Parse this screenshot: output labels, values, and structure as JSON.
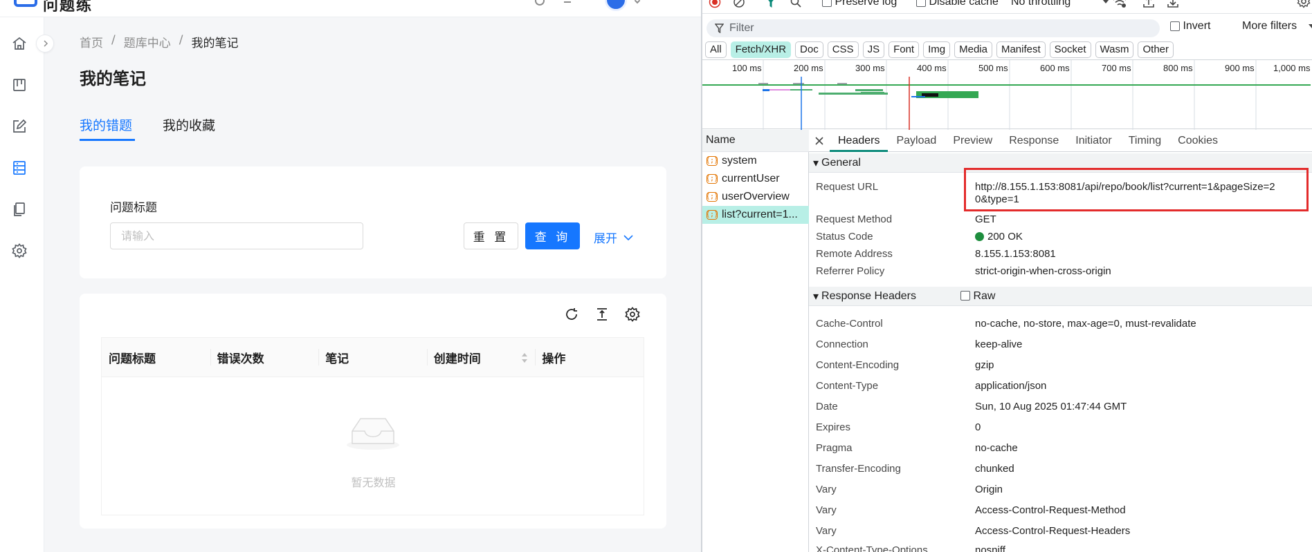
{
  "app": {
    "logo_text": "问题练",
    "breadcrumb": {
      "home": "首页",
      "sep": "/",
      "center": "题库中心",
      "current": "我的笔记"
    },
    "page_title": "我的笔记",
    "tabs": {
      "errors": "我的错题",
      "favorites": "我的收藏"
    },
    "search": {
      "label": "问题标题",
      "placeholder": "请输入",
      "reset": "重 置",
      "query": "查 询",
      "expand": "展开"
    },
    "table": {
      "columns": [
        "问题标题",
        "错误次数",
        "笔记",
        "创建时间",
        "操作"
      ],
      "empty_text": "暂无数据"
    },
    "sidebar_icons": [
      "home-icon",
      "board-icon",
      "edit-icon",
      "list-icon",
      "copy-icon",
      "settings-icon"
    ],
    "accent": "#1677ff"
  },
  "devtools": {
    "toolbar": {
      "preserve_log": "Preserve log",
      "disable_cache": "Disable cache",
      "throttling": "No throttling"
    },
    "filter": {
      "placeholder": "Filter",
      "invert": "Invert",
      "more_filters": "More filters"
    },
    "types": [
      "All",
      "Fetch/XHR",
      "Doc",
      "CSS",
      "JS",
      "Font",
      "Img",
      "Media",
      "Manifest",
      "Socket",
      "Wasm",
      "Other"
    ],
    "active_type": "Fetch/XHR",
    "timeline_ticks": [
      "100 ms",
      "200 ms",
      "300 ms",
      "400 ms",
      "500 ms",
      "600 ms",
      "700 ms",
      "800 ms",
      "900 ms",
      "1,000 ms"
    ],
    "name_header": "Name",
    "requests": [
      "system",
      "currentUser",
      "userOverview",
      "list?current=1..."
    ],
    "selected_request": 3,
    "detail_tabs": [
      "Headers",
      "Payload",
      "Preview",
      "Response",
      "Initiator",
      "Timing",
      "Cookies"
    ],
    "general": {
      "title": "General",
      "rows": [
        {
          "key": "Request URL",
          "value": "http://8.155.1.153:8081/api/repo/book/list?current=1&pageSize=2",
          "value2": "0&type=1"
        },
        {
          "key": "Request Method",
          "value": "GET"
        },
        {
          "key": "Status Code",
          "value": "200 OK"
        },
        {
          "key": "Remote Address",
          "value": "8.155.1.153:8081"
        },
        {
          "key": "Referrer Policy",
          "value": "strict-origin-when-cross-origin"
        }
      ]
    },
    "response_headers": {
      "title": "Response Headers",
      "raw_label": "Raw",
      "rows": [
        {
          "key": "Cache-Control",
          "value": "no-cache, no-store, max-age=0, must-revalidate"
        },
        {
          "key": "Connection",
          "value": "keep-alive"
        },
        {
          "key": "Content-Encoding",
          "value": "gzip"
        },
        {
          "key": "Content-Type",
          "value": "application/json"
        },
        {
          "key": "Date",
          "value": "Sun, 10 Aug 2025 01:47:44 GMT"
        },
        {
          "key": "Expires",
          "value": "0"
        },
        {
          "key": "Pragma",
          "value": "no-cache"
        },
        {
          "key": "Transfer-Encoding",
          "value": "chunked"
        },
        {
          "key": "Vary",
          "value": "Origin"
        },
        {
          "key": "Vary",
          "value": "Access-Control-Request-Method"
        },
        {
          "key": "Vary",
          "value": "Access-Control-Request-Headers"
        },
        {
          "key": "X-Content-Type-Options",
          "value": "nosniff"
        }
      ]
    },
    "status_color": "#1e8e3e",
    "highlight_color": "#e32b2b"
  }
}
